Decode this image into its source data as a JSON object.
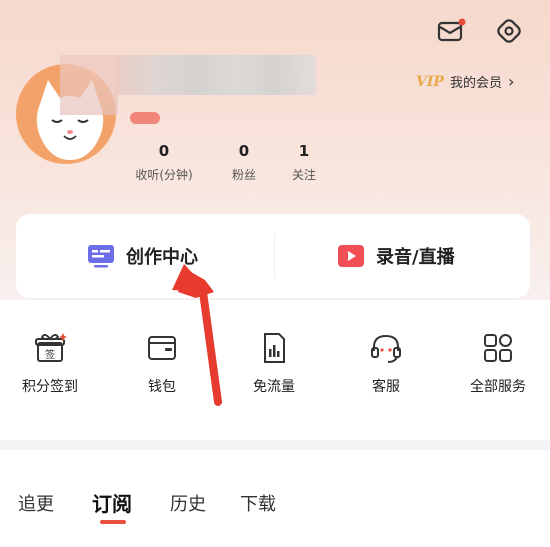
{
  "header": {
    "vip_badge": "VIP",
    "vip_label": "我的会员"
  },
  "stats": [
    {
      "num": "0",
      "label": "收听(分钟)"
    },
    {
      "num": "0",
      "label": "粉丝"
    },
    {
      "num": "1",
      "label": "关注"
    }
  ],
  "creator": {
    "center_label": "创作中心",
    "record_label": "录音/直播"
  },
  "services": [
    {
      "label": "积分签到",
      "icon": "gift-sign-icon"
    },
    {
      "label": "钱包",
      "icon": "wallet-icon"
    },
    {
      "label": "免流量",
      "icon": "data-free-icon"
    },
    {
      "label": "客服",
      "icon": "headset-icon"
    },
    {
      "label": "全部服务",
      "icon": "grid-icon"
    }
  ],
  "tabs": [
    {
      "label": "追更"
    },
    {
      "label": "订阅"
    },
    {
      "label": "历史"
    },
    {
      "label": "下载"
    }
  ],
  "colors": {
    "accent": "#e8503c",
    "vip": "#e8a94a",
    "header_bg": "#f6d8cc",
    "annotation_arrow": "#e63b2e"
  }
}
